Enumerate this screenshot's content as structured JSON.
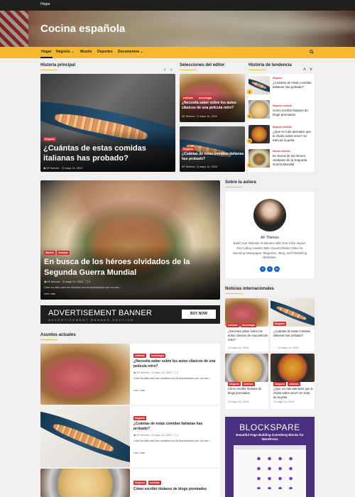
{
  "topbar": {
    "home_link": "Hogar"
  },
  "site": {
    "title": "Cocina española"
  },
  "nav": {
    "items": [
      {
        "label": "Hogar",
        "active": true
      },
      {
        "label": "Negocio",
        "has_dropdown": true
      },
      {
        "label": "Mundo"
      },
      {
        "label": "Deportes"
      },
      {
        "label": "Documentos",
        "has_dropdown": true
      }
    ],
    "search_icon": "search-icon"
  },
  "sections": {
    "main_story": "Historia principal",
    "editor_picks": "Selecciones del editor",
    "trending": "Historia de tendencia",
    "about_author": "Sobre la autora",
    "international": "Noticias internacionales",
    "current_affairs": "Asuntos actuales"
  },
  "main_story": {
    "category": "Negocio",
    "title": "¿Cuántas de estas comidas italianas has probado?",
    "author": "AF themes",
    "date": "mayo 14, 2024"
  },
  "editor_picks": [
    {
      "categories": [
        "noticias",
        "tecnología"
      ],
      "title": "¿Necesita saber sobre los autos clásicos de una película retro?",
      "author": "AF themes",
      "date": "mayo 14, 2024"
    },
    {
      "categories": [
        "Negocio"
      ],
      "title": "¿Cuántas de estas comidas italianas has probado?",
      "author": "AF themes",
      "date": "mayo 14, 2024"
    }
  ],
  "trending": [
    {
      "num": "1",
      "category": "Negocio",
      "title": "¿Cuántas de estas comidas italianas has probado?"
    },
    {
      "num": "2",
      "category": "Negocio   noticias",
      "title": "Cómo escribir titulares de blogs premiados"
    },
    {
      "num": "3",
      "category": "Negocio   noticias",
      "title": "¿Qué es más aterrador que le charla sobre sexo? Se trata de la pesa"
    },
    {
      "num": "4",
      "category": "Mundo   noticias",
      "title": "En busca de los héroes olvidados de la Segunda Guerra Mundial"
    }
  ],
  "feature": {
    "categories": [
      "Mundo",
      "noticias"
    ],
    "title": "En busca de los héroes olvidados de la Segunda Guerra Mundial",
    "author": "AF themes",
    "date": "mayo 14, 2024",
    "comments": "0",
    "excerpt": "Cree su sitio web en minutos con la importación con un solo…",
    "more": "Leer más"
  },
  "ad": {
    "title": "ADVERTISEMENT BANNER",
    "subtitle": "ADVERTISEMENT BANNER SECTION",
    "button": "BUY NOW"
  },
  "current_affairs": [
    {
      "categories": [
        "noticias",
        "tecnología"
      ],
      "title": "¿Necesita saber sobre los autos clásicos de una película retro?",
      "author": "AF themes",
      "date": "mayo 14, 2024",
      "comments": "0",
      "excerpt": "Cree su sitio web en minutos con la importación con un solo…",
      "more": "Leer más"
    },
    {
      "categories": [
        "Negocio"
      ],
      "title": "¿Cuántas de estas comidas italianas has probado?",
      "author": "AF themes",
      "date": "mayo 14, 2024",
      "comments": "0",
      "excerpt": "Cree su sitio web en minutos con la importación con un solo…",
      "more": "Leer más"
    },
    {
      "categories": [
        "Negocio",
        "noticias"
      ],
      "title": "Cómo escribir titulares de blogs premiados"
    }
  ],
  "author_box": {
    "name": "AF Themes",
    "bio": "Build Your Website in Minutes with One-Click Import ​​​​No Coding Hassle! 365+ Expert Starter Sites for Stunning Newspaper, Magazine, Blog, and Publishing Websites.",
    "socials": [
      {
        "icon": "facebook-icon",
        "glyph": "f"
      },
      {
        "icon": "twitter-icon",
        "glyph": "t"
      },
      {
        "icon": "linkedin-icon",
        "glyph": "in"
      }
    ]
  },
  "international": [
    {
      "categories": [
        "noticias",
        "tecnología"
      ],
      "title": "¿Necesita saber sobre los autos clásicos de una película retro?",
      "date": "mayo 14, 2024"
    },
    {
      "categories": [
        "Negocio"
      ],
      "title": "¿Cuántas de estas comidas italianas has probado?",
      "date": "mayo 14, 2024"
    },
    {
      "categories": [
        "Negocio",
        "noticias"
      ],
      "title": "Cómo escribir titulares de blogs premiados",
      "date": "mayo 14, 2024"
    },
    {
      "categories": [
        "Negocio",
        "noticias"
      ],
      "title": "¿Qué es más aterrador que le charla sobre sexo? Se trata de la pesa",
      "date": "mayo 14, 2024"
    }
  ],
  "blockspare": {
    "logo": "BLOCKSPARE",
    "subtitle": "Beautiful Page Building Gutenberg Blocks for WordPress"
  },
  "colors": {
    "accent": "#f5b82e",
    "badge": "#d63031",
    "dark": "#1f1f1f",
    "promo": "#4a2f7e"
  }
}
